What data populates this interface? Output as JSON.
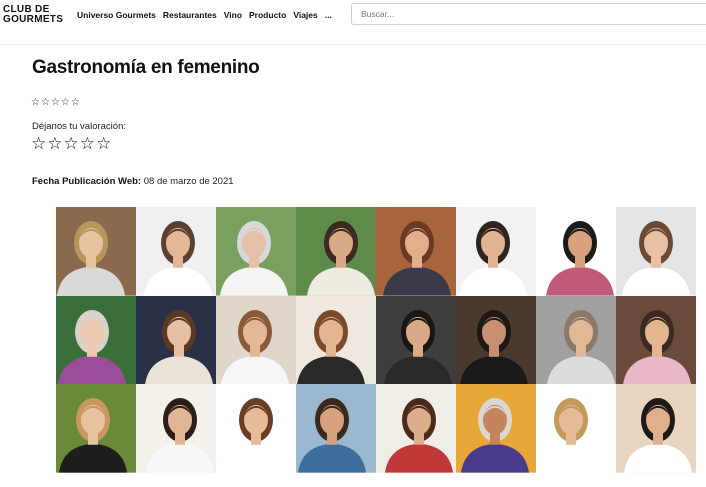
{
  "header": {
    "logo_line1": "CLUB DE",
    "logo_line2": "GOURMETS",
    "nav": [
      "Universo Gourmets",
      "Restaurantes",
      "Vino",
      "Producto",
      "Viajes",
      "..."
    ],
    "search_placeholder": "Buscar..."
  },
  "article": {
    "title": "Gastronomía en femenino",
    "rating_stars": [
      "☆",
      "☆",
      "☆",
      "☆",
      "☆"
    ],
    "rate_label": "Déjanos tu valoración:",
    "rate_stars": [
      "☆",
      "☆",
      "☆",
      "☆",
      "☆"
    ],
    "pub_label": "Fecha Publicación Web:",
    "pub_date": "08 de marzo de 2021"
  },
  "collage": {
    "tiles": [
      {
        "bg": "#8a6a4e",
        "skin": "#e8c2a0",
        "hair": "#b8955a",
        "shirt": "#d9d9d9"
      },
      {
        "bg": "#f0f0f0",
        "skin": "#e4b896",
        "hair": "#5a4030",
        "shirt": "#ffffff"
      },
      {
        "bg": "#7aa060",
        "skin": "#e6c0a8",
        "hair": "#d8d8d8",
        "shirt": "#f4f4f4"
      },
      {
        "bg": "#5e8a4a",
        "skin": "#d9a886",
        "hair": "#3a2a20",
        "shirt": "#efeae0"
      },
      {
        "bg": "#a8643c",
        "skin": "#e2ae8c",
        "hair": "#6a3a24",
        "shirt": "#3a3a4a"
      },
      {
        "bg": "#f2f2f2",
        "skin": "#e0b490",
        "hair": "#2e2420",
        "shirt": "#ffffff"
      },
      {
        "bg": "#ffffff",
        "skin": "#d8a27e",
        "hair": "#1e1a18",
        "shirt": "#c05a78"
      },
      {
        "bg": "#e4e4e4",
        "skin": "#e8c0a4",
        "hair": "#6a4a34",
        "shirt": "#ffffff"
      },
      {
        "bg": "#3a6e3a",
        "skin": "#eccab2",
        "hair": "#d8d2c8",
        "shirt": "#9a4e9a"
      },
      {
        "bg": "#2a3046",
        "skin": "#e6c0a0",
        "hair": "#5a3a24",
        "shirt": "#e8e2d8"
      },
      {
        "bg": "#e0d6ca",
        "skin": "#e4b896",
        "hair": "#8a5a3a",
        "shirt": "#f6f6f6"
      },
      {
        "bg": "#efe8e0",
        "skin": "#e2b492",
        "hair": "#7a4a2a",
        "shirt": "#2a2a2a"
      },
      {
        "bg": "#3e3e3e",
        "skin": "#d8aa88",
        "hair": "#1a1614",
        "shirt": "#2a2a2a"
      },
      {
        "bg": "#4a3a2e",
        "skin": "#c89070",
        "hair": "#1e1814",
        "shirt": "#1a1a1a"
      },
      {
        "bg": "#a0a0a0",
        "skin": "#e0b894",
        "hair": "#8a7a6a",
        "shirt": "#dcdcdc"
      },
      {
        "bg": "#6a4a3a",
        "skin": "#e4b690",
        "hair": "#3a2a22",
        "shirt": "#e8b8c8"
      },
      {
        "bg": "#6a8a3a",
        "skin": "#e8c2a0",
        "hair": "#c89860",
        "shirt": "#1e1e1e"
      },
      {
        "bg": "#f4f0ea",
        "skin": "#e0b694",
        "hair": "#2a1e18",
        "shirt": "#f8f8f8"
      },
      {
        "bg": "#ffffff",
        "skin": "#e6bc98",
        "hair": "#6a3e24",
        "shirt": "#ffffff"
      },
      {
        "bg": "#9ab8d0",
        "skin": "#d8a280",
        "hair": "#3a2a1e",
        "shirt": "#3e6e9a"
      },
      {
        "bg": "#f0ece6",
        "skin": "#dcae8c",
        "hair": "#4a2a1a",
        "shirt": "#c03838"
      },
      {
        "bg": "#e8a838",
        "skin": "#c4845e",
        "hair": "#d8d8d0",
        "shirt": "#4a3a8a"
      },
      {
        "bg": "#ffffff",
        "skin": "#e4ba98",
        "hair": "#c49a5a",
        "shirt": "#ffffff"
      },
      {
        "bg": "#e8d6c0",
        "skin": "#e0b08c",
        "hair": "#1e1a18",
        "shirt": "#ffffff"
      }
    ]
  }
}
